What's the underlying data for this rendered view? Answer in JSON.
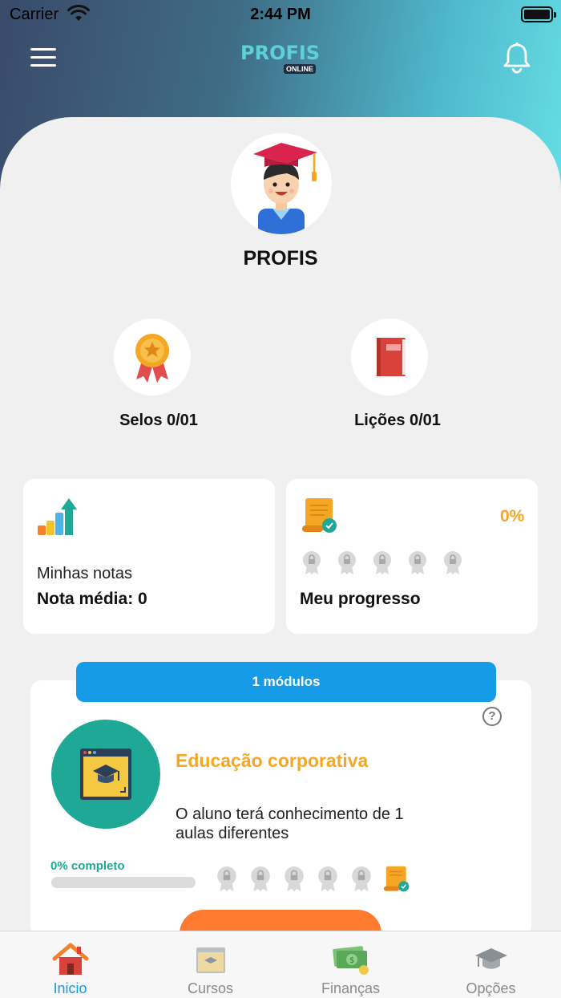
{
  "status_bar": {
    "carrier": "Carrier",
    "time": "2:44 PM"
  },
  "header": {
    "logo_main": "PROFIS",
    "logo_sub": "ONLINE"
  },
  "profile": {
    "name": "PROFIS"
  },
  "stats": {
    "seals": {
      "label": "Selos 0/01",
      "icon": "award-medal-icon"
    },
    "lessons": {
      "label": "Lições 0/01",
      "icon": "red-book-icon"
    }
  },
  "grades_card": {
    "caption": "Minhas notas",
    "average": "Nota média: 0",
    "icon": "growth-chart-icon"
  },
  "progress_card": {
    "percent": "0%",
    "title": "Meu progresso",
    "icon": "certificate-scroll-icon",
    "locked_badges": 5
  },
  "modules": {
    "count_label": "1 módulos",
    "course_title": "Educação corporativa",
    "course_description": "O aluno terá conhecimento de 1 aulas diferentes",
    "progress_label": "0% completo",
    "progress_value": 0,
    "locked_badges": 5
  },
  "tabs": [
    {
      "label": "Inicio",
      "icon": "home-icon",
      "active": true
    },
    {
      "label": "Cursos",
      "icon": "courses-icon",
      "active": false
    },
    {
      "label": "Finanças",
      "icon": "money-icon",
      "active": false
    },
    {
      "label": "Opções",
      "icon": "graduation-cap-icon",
      "active": false
    }
  ],
  "colors": {
    "accent": "#169be6",
    "teal": "#1fa896",
    "orange": "#f5a623",
    "button_orange": "#ff7a2f"
  }
}
